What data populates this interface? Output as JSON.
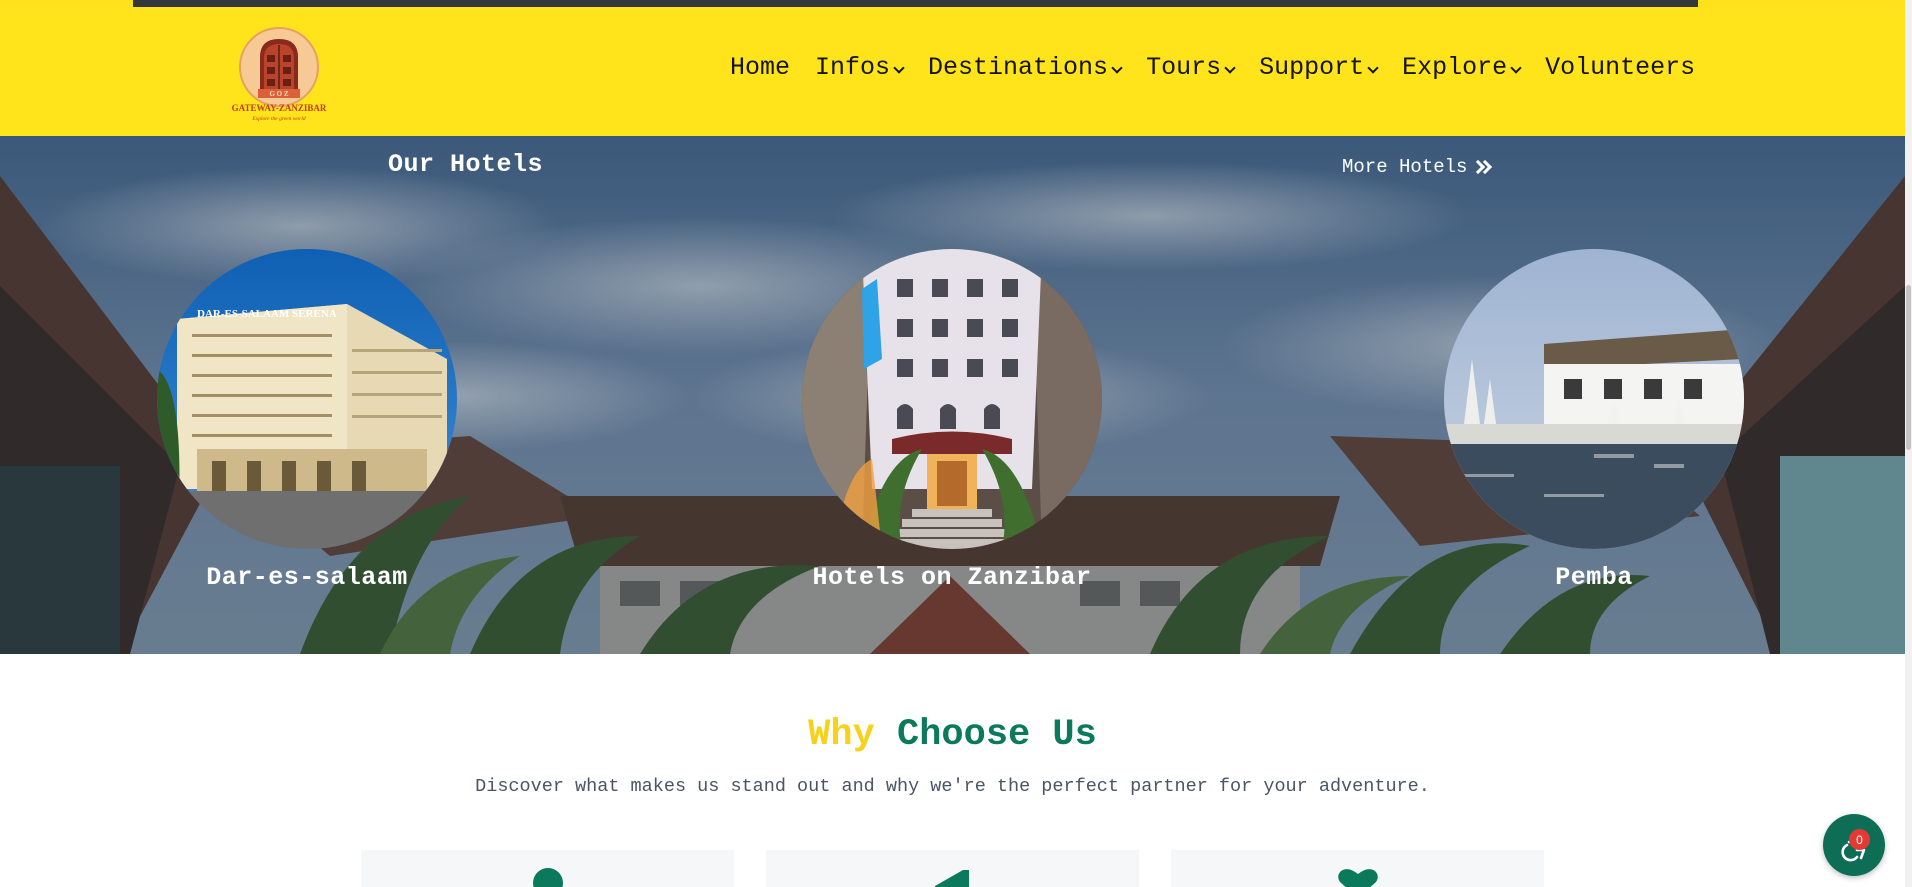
{
  "header": {
    "logo_alt": "GATEWAY ZANZIBAR logo",
    "logo_text": "GATEWAY-ZANZIBAR",
    "logo_monogram": "G O Z",
    "logo_tagline": "Explore the green world",
    "nav": [
      {
        "label": "Home",
        "dropdown": false
      },
      {
        "label": "Infos",
        "dropdown": true
      },
      {
        "label": "Destinations",
        "dropdown": true
      },
      {
        "label": "Tours",
        "dropdown": true
      },
      {
        "label": "Support",
        "dropdown": true
      },
      {
        "label": "Explore",
        "dropdown": true
      },
      {
        "label": "Volunteers",
        "dropdown": false
      }
    ]
  },
  "hotels": {
    "title": "Our Hotels",
    "more_label": "More Hotels",
    "items": [
      {
        "name": "Dar-es-salaam"
      },
      {
        "name": "Hotels on Zanzibar"
      },
      {
        "name": "Pemba"
      }
    ]
  },
  "why": {
    "title_part1": "Why",
    "title_part2": "Choose Us",
    "subtitle": "Discover what makes us stand out and why we're the perfect partner for your adventure."
  },
  "accessibility": {
    "badge_count": "0"
  },
  "colors": {
    "header_yellow": "#ffe31b",
    "brand_green": "#0b7a5c",
    "accent_yellow": "#f7d21c",
    "badge_red": "#e53935"
  }
}
